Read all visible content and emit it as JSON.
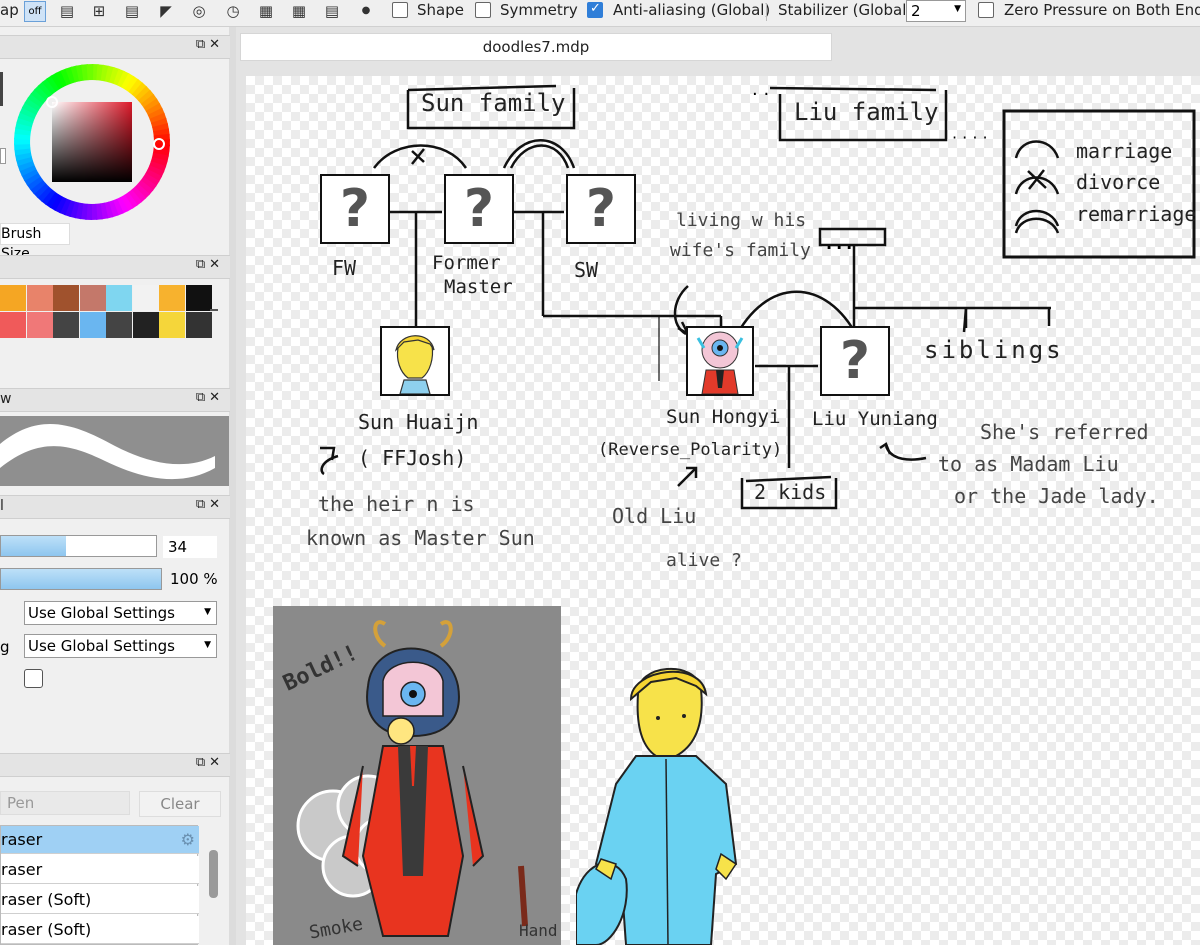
{
  "toolbar": {
    "snap_label": "ap",
    "snap_off_label": "off",
    "shape_label": "Shape",
    "symmetry_label": "Symmetry",
    "antialias_label": "Anti-aliasing (Global)",
    "stabilizer_label": "Stabilizer (Global)",
    "stabilizer_value": "2",
    "zero_pressure_label": "Zero Pressure on Both Ends",
    "shape_checked": false,
    "symmetry_checked": false,
    "antialias_checked": true,
    "zero_pressure_checked": false
  },
  "document": {
    "tab_title": "doodles7.mdp"
  },
  "color_panel": {
    "brush_size_label": "Brush Size"
  },
  "palette": {
    "row1": [
      "#f5a623",
      "#e8836a",
      "#a0522d",
      "#c4786a",
      "#7fd6f0",
      "#f2f2f2",
      "#f7b22e",
      "#111111"
    ],
    "row2": [
      "#f05a5a",
      "#f07878",
      "#444444",
      "#6ab6f0",
      "#444444",
      "#222222",
      "#f5d63a",
      "#333333"
    ]
  },
  "preview_panel": {
    "title": "w"
  },
  "brush_panel": {
    "title": "l",
    "size_value": "34",
    "size_percent": 0.42,
    "opacity_value": "100 %",
    "opacity_percent": 1.0,
    "setting1": "Use Global Settings",
    "setting2_label": "g",
    "setting2": "Use Global Settings"
  },
  "brush_list": {
    "search_placeholder": "Pen",
    "clear_label": "Clear",
    "items": [
      "raser",
      "raser",
      "raser (Soft)",
      "raser (Soft)"
    ]
  },
  "drawing": {
    "sun_family": "Sun family",
    "liu_family": "Liu family",
    "legend_marriage": "marriage",
    "legend_divorce": "divorce",
    "legend_remarriage": "remarriage",
    "fw": "FW",
    "former_master_1": "Former",
    "former_master_2": "Master",
    "sw": "SW",
    "living_note_1": "living w his",
    "living_note_2": "wife's family",
    "siblings": "siblings",
    "sun_huaijn": "Sun Huaijn",
    "ffjosh": "( FFJosh)",
    "heir_note_1": "the heir n is",
    "heir_note_2": "known as  Master Sun",
    "sun_hongyi": "Sun Hongyi",
    "reverse_polarity": "(Reverse_Polarity)",
    "liu_yuniang": "Liu Yuniang",
    "two_kids": "2 kids",
    "old_liu": "Old Liu",
    "alive": "alive ?",
    "madam_1": "She's referred",
    "madam_2": "to as Madam Liu",
    "madam_3": "or the Jade lady.",
    "bold_note": "Bold!!",
    "smoke_note": "Smoke",
    "hand_note": "Hand",
    "dots_box": "..."
  }
}
